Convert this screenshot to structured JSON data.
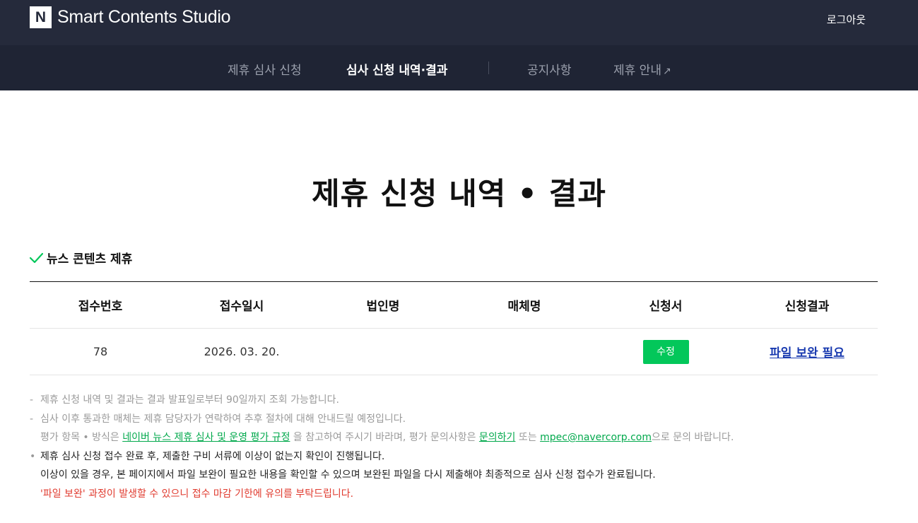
{
  "header": {
    "logo_letter": "N",
    "brand": "Smart Contents Studio",
    "logout_label": "로그아웃"
  },
  "nav": {
    "items": [
      {
        "label": "제휴 심사 신청"
      },
      {
        "label": "심사 신청 내역·결과"
      },
      {
        "label": "공지사항"
      },
      {
        "label": "제휴 안내",
        "arrow": "↗"
      }
    ],
    "active_index": 1
  },
  "page": {
    "title": "제휴 신청 내역 • 결과"
  },
  "section": {
    "label": "뉴스 콘텐츠 제휴",
    "icon": "check-icon"
  },
  "table": {
    "headers": [
      "접수번호",
      "접수일시",
      "법인명",
      "매체명",
      "신청서",
      "신청결과"
    ],
    "rows": [
      {
        "receipt_no": "78",
        "receipt_date": "2026. 03. 20.",
        "corporation": "",
        "media": "",
        "application_button": "수정",
        "result_link": "파일 보완 필요"
      }
    ]
  },
  "notes": {
    "bullet": "-",
    "line1": "제휴 신청 내역 및 결과는 결과 발표일로부터 90일까지 조회 가능합니다.",
    "line2": "심사 이후 통과한 매체는 제휴 담당자가 연락하여 추후 절차에 대해 안내드릴 예정입니다.",
    "line3_prefix": "평가 항목 • 방식은 ",
    "line3_link1": "네이버 뉴스 제휴 심사 및 운영 평가 규정",
    "line3_mid": " 을 참고하여 주시기 바라며, 평가 문의사항은 ",
    "line3_link2": "문의하기",
    "line3_mid2": " 또는 ",
    "line3_email": "mpec@navercorp.com",
    "line3_suffix": "으로 문의 바랍니다.",
    "bullet_dot": "•",
    "line4": "제휴 심사 신청 접수 완료 후, 제출한 구비 서류에 이상이 없는지 확인이 진행됩니다.",
    "line5": "이상이 있을 경우, 본 페이지에서 파일 보완이 필요한 내용을 확인할 수 있으며 보완된 파일을 다시 제출해야 최종적으로 심사 신청 접수가 완료됩니다.",
    "line6": "'파일 보완' 과정이 발생할 수 있으니 접수 마감 기한에 유의를 부탁드립니다."
  },
  "colors": {
    "header_bg": "#252a3b",
    "nav_bg": "#1f2434",
    "accent_green": "#03c75a",
    "link_blue": "#1a3bb0",
    "warning_red": "#e03a2e"
  }
}
